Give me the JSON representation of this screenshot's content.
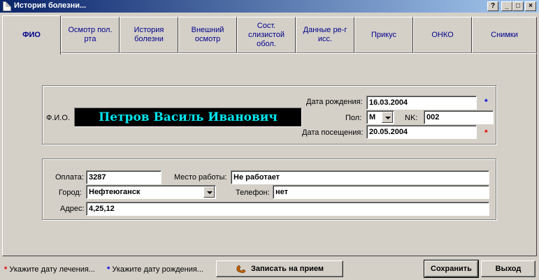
{
  "window": {
    "title": "История болезни...",
    "help_label": "?",
    "min_label": "_",
    "max_label": "□",
    "close_label": "×"
  },
  "tabs": [
    {
      "label": "ФИО"
    },
    {
      "label": "Осмотр пол. рта"
    },
    {
      "label": "История болезни"
    },
    {
      "label": "Внешний осмотр"
    },
    {
      "label": "Сост. слизистой обол."
    },
    {
      "label": "Данные ре-г исс."
    },
    {
      "label": "Прикус"
    },
    {
      "label": "ОНКО"
    },
    {
      "label": "Снимки"
    }
  ],
  "patient": {
    "fio_label": "Ф.И.О.",
    "fio_value": "Петров Василь Иванович",
    "birth_label": "Дата рождения:",
    "birth_value": "16.03.2004",
    "sex_label": "Пол:",
    "sex_value": "М",
    "nk_label": "NK:",
    "nk_value": "002",
    "visit_label": "Дата посещения:",
    "visit_value": "20.05.2004"
  },
  "details": {
    "payment_label": "Оплата:",
    "payment_value": "3287",
    "work_label": "Место работы:",
    "work_value": "Не работает",
    "city_label": "Город:",
    "city_value": "Нефтеюганск",
    "phone_label": "Телефон:",
    "phone_value": "нет",
    "address_label": "Адрес:",
    "address_value": "4,25,12"
  },
  "footer": {
    "hint_red": "Укажите дату лечения...",
    "hint_blue": "Укажите дату рождения...",
    "appointment_label": "Записать на прием",
    "save_label": "Сохранить",
    "exit_label": "Выход",
    "star_glyph": "*"
  },
  "colors": {
    "required_red": "#e00000",
    "required_blue": "#0000e0",
    "tab_text": "#00008b",
    "name_text": "#00e5ee"
  }
}
